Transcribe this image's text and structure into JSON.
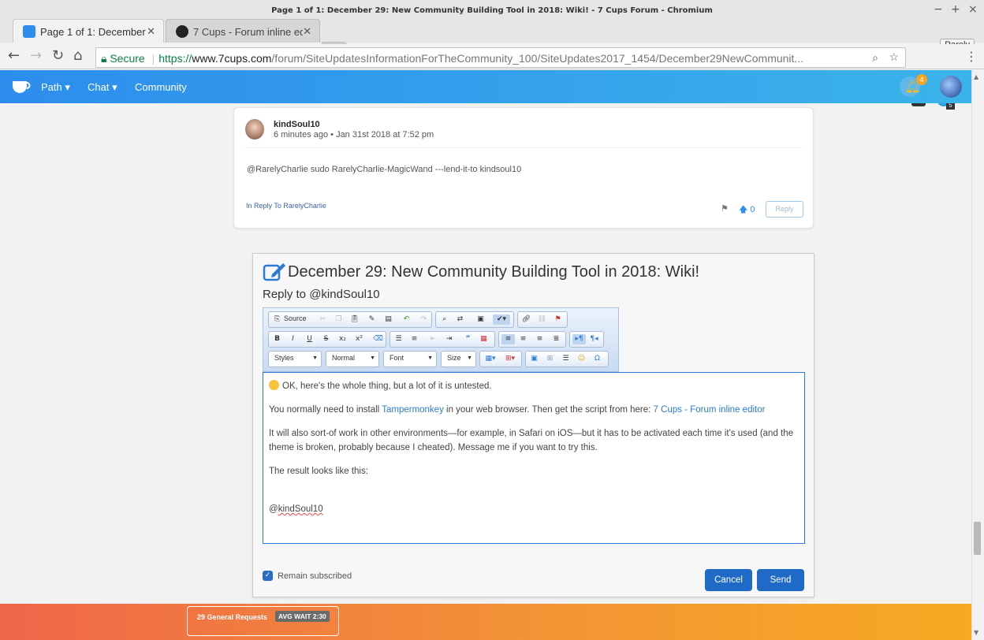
{
  "window": {
    "title": "Page 1 of 1: December 29: New Community Building Tool in 2018: Wiki! - 7 Cups Forum - Chromium",
    "profile": "Rarely"
  },
  "tabs": [
    {
      "label": "Page 1 of 1: December",
      "active": true
    },
    {
      "label": "7 Cups - Forum inline ed",
      "active": false
    }
  ],
  "address_bar": {
    "secure_label": "Secure",
    "url_scheme": "https://",
    "url_host": "www.7cups.com",
    "url_path": "/forum/SiteUpdatesInformationForTheCommunity_100/SiteUpdates2017_1454/December29NewCommunit..."
  },
  "extensions": {
    "badge_count": "5"
  },
  "site_nav": {
    "items": [
      "Path ▾",
      "Chat ▾",
      "Community"
    ],
    "notification_count": "4"
  },
  "post": {
    "username": "kindSoul10",
    "meta": "6 minutes ago • Jan 31st 2018 at 7:52 pm",
    "body": "@RarelyCharlie sudo RarelyCharlie-MagicWand ---lend-it-to kindsoul10",
    "in_reply_to": "In Reply To RarelyCharlie",
    "votes": "0",
    "reply_label": "Reply"
  },
  "editor": {
    "title": "December 29: New Community Building Tool in 2018: Wiki!",
    "subtitle": "Reply to @kindSoul10",
    "toolbar": {
      "source_label": "Source",
      "styles_label": "Styles",
      "format_label": "Normal",
      "font_label": "Font",
      "size_label": "Size"
    },
    "content": {
      "p1": "OK, here's the whole thing, but a lot of it is untested.",
      "p2_before": "You normally need to install ",
      "p2_link1": "Tampermonkey",
      "p2_middle": " in your web browser. Then get the script from here: ",
      "p2_link2": "7 Cups - Forum inline editor",
      "p3": "It will also sort-of work in other environments—for example, in Safari on iOS—but it has to be activated each time it's used (and the theme is broken, probably because I cheated). Message me if you want to try this.",
      "p4": "The result looks like this:",
      "mention_at": "@",
      "mention_name": "kindSoul10"
    },
    "remain_subscribed_label": "Remain subscribed",
    "remain_subscribed": true,
    "cancel_label": "Cancel",
    "send_label": "Send"
  },
  "footer": {
    "requests_label": "29 General Requests",
    "wait_label": "AVG WAIT 2:30"
  },
  "colors": {
    "nav_gradient_start": "#2d8ded",
    "nav_gradient_end": "#3ab3ea",
    "primary_button": "#1f6ac6",
    "footer_start": "#f0664a",
    "footer_end": "#f7a922",
    "secure_green": "#0b8043"
  }
}
